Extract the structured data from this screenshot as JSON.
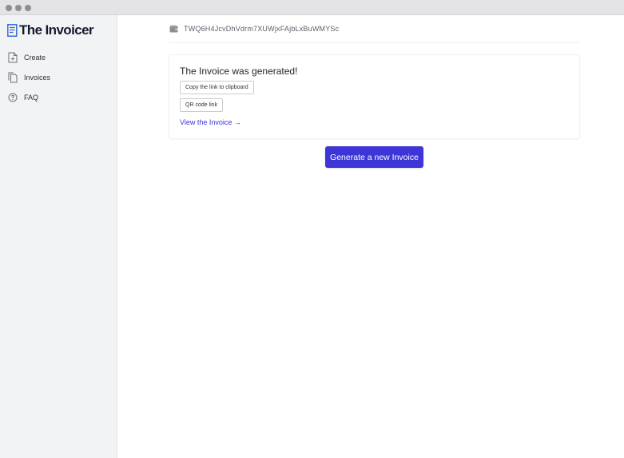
{
  "app": {
    "brand_name": "The Invoicer"
  },
  "sidebar": {
    "items": [
      {
        "label": "Create",
        "icon": "document-plus-icon"
      },
      {
        "label": "Invoices",
        "icon": "documents-icon"
      },
      {
        "label": "FAQ",
        "icon": "question-circle-icon"
      }
    ]
  },
  "header": {
    "wallet_icon": "wallet-icon",
    "address": "TWQ6H4JcvDhVdrm7XUWjxFAjbLxBuWMYSc"
  },
  "result_card": {
    "title": "The Invoice was generated!",
    "copy_label": "Copy the link to clipboard",
    "qr_label": "QR code link",
    "view_label": "View the Invoice →"
  },
  "actions": {
    "new_invoice_label": "Generate a new Invoice"
  },
  "colors": {
    "accent": "#3d35d8",
    "link": "#3b34d6",
    "sidebar_bg": "#f2f3f5",
    "logo_blue": "#2a63d8"
  }
}
